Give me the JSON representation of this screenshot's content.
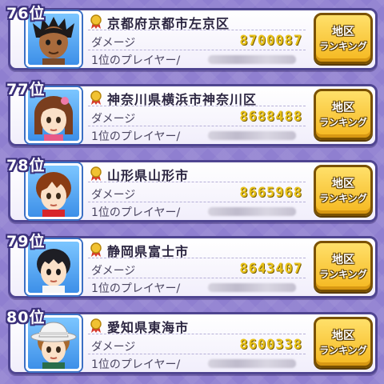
{
  "colors": {
    "background": "#8f7fd0",
    "card_border": "#4f4591",
    "damage_value": "#e8c21a",
    "button": "#f5b820"
  },
  "entries": [
    {
      "rank": "76位",
      "region": "京都府京都市左京区",
      "damage_label": "ダメージ",
      "damage_value": "8700087",
      "player_label": "1位のプレイヤー/",
      "button_line1": "地区",
      "button_line2": "ランキング",
      "avatar_icon": "dark-haired-boy-avatar"
    },
    {
      "rank": "77位",
      "region": "神奈川県横浜市神奈川区",
      "damage_label": "ダメージ",
      "damage_value": "8688488",
      "player_label": "1位のプレイヤー/",
      "button_line1": "地区",
      "button_line2": "ランキング",
      "avatar_icon": "brown-haired-girl-avatar"
    },
    {
      "rank": "78位",
      "region": "山形県山形市",
      "damage_label": "ダメージ",
      "damage_value": "8665968",
      "player_label": "1位のプレイヤー/",
      "button_line1": "地区",
      "button_line2": "ランキング",
      "avatar_icon": "brown-haired-boy-avatar"
    },
    {
      "rank": "79位",
      "region": "静岡県富士市",
      "damage_label": "ダメージ",
      "damage_value": "8643407",
      "player_label": "1位のプレイヤー/",
      "button_line1": "地区",
      "button_line2": "ランキング",
      "avatar_icon": "black-haired-boy-avatar"
    },
    {
      "rank": "80位",
      "region": "愛知県東海市",
      "damage_label": "ダメージ",
      "damage_value": "8600338",
      "player_label": "1位のプレイヤー/",
      "button_line1": "地区",
      "button_line2": "ランキング",
      "avatar_icon": "white-hat-boy-avatar"
    }
  ]
}
